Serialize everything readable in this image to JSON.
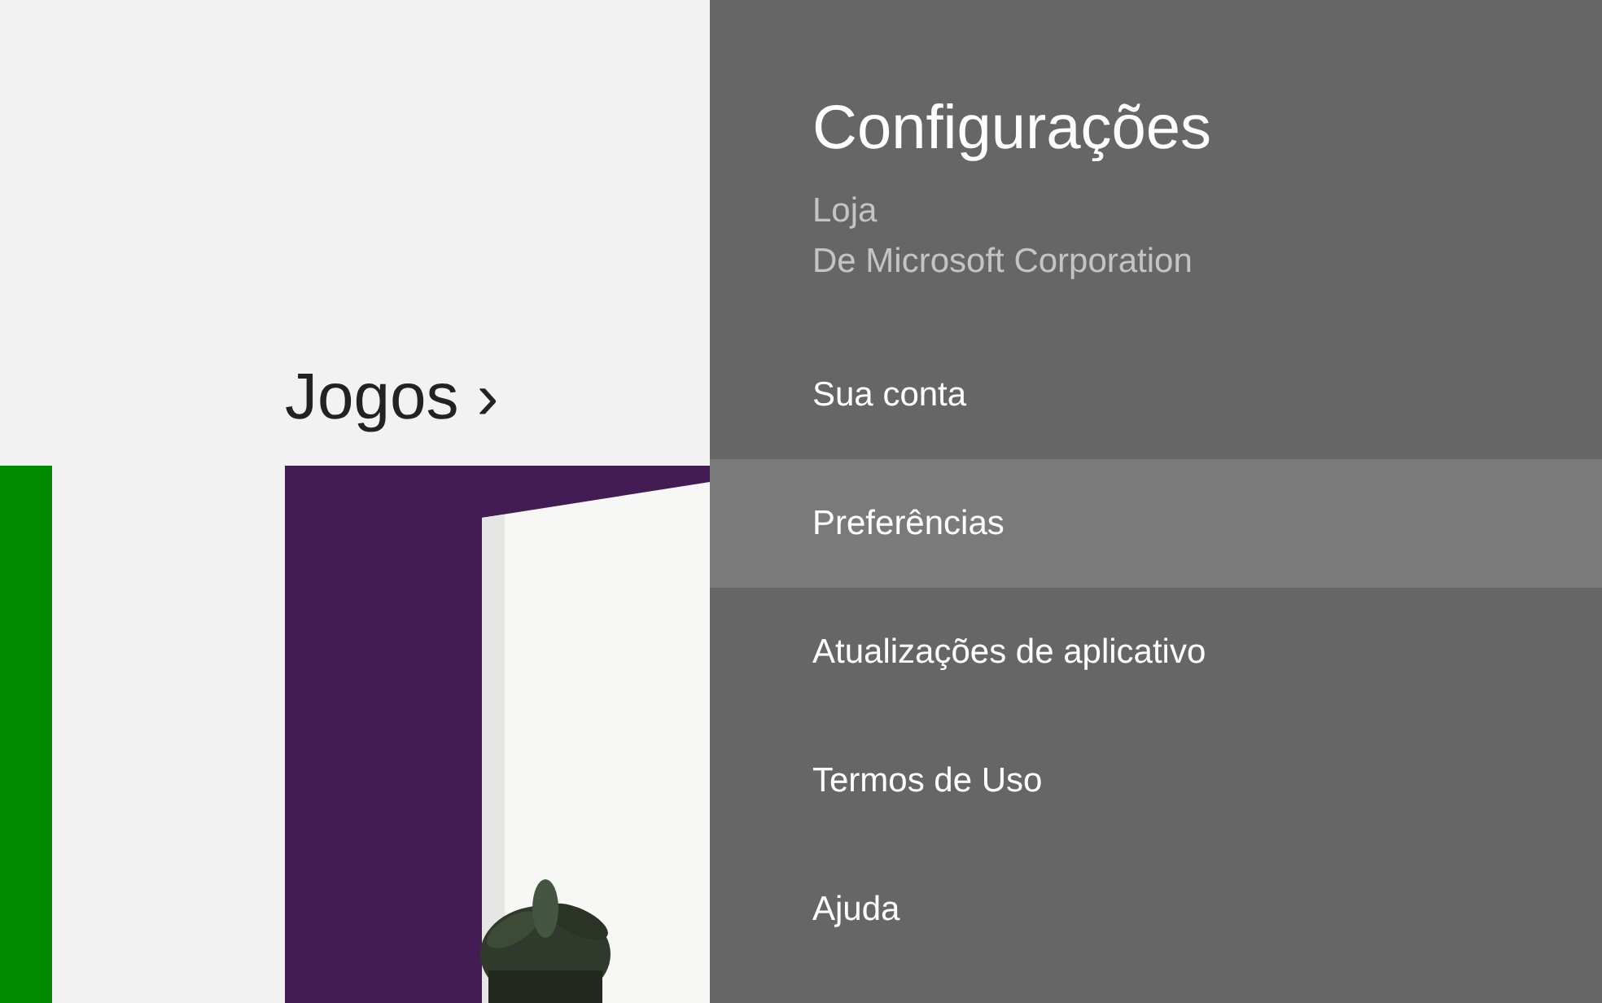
{
  "store": {
    "section_title": "Jogos ›",
    "tiles": [
      {
        "kind": "color",
        "color": "#008a00"
      },
      {
        "kind": "picture",
        "color": "#441c54"
      }
    ]
  },
  "settings_panel": {
    "title": "Configurações",
    "app_name": "Loja",
    "publisher": "De Microsoft Corporation",
    "items": [
      {
        "label": "Sua conta",
        "selected": false
      },
      {
        "label": "Preferências",
        "selected": true
      },
      {
        "label": "Atualizações de aplicativo",
        "selected": false
      },
      {
        "label": "Termos de Uso",
        "selected": false
      },
      {
        "label": "Ajuda",
        "selected": false
      }
    ]
  }
}
